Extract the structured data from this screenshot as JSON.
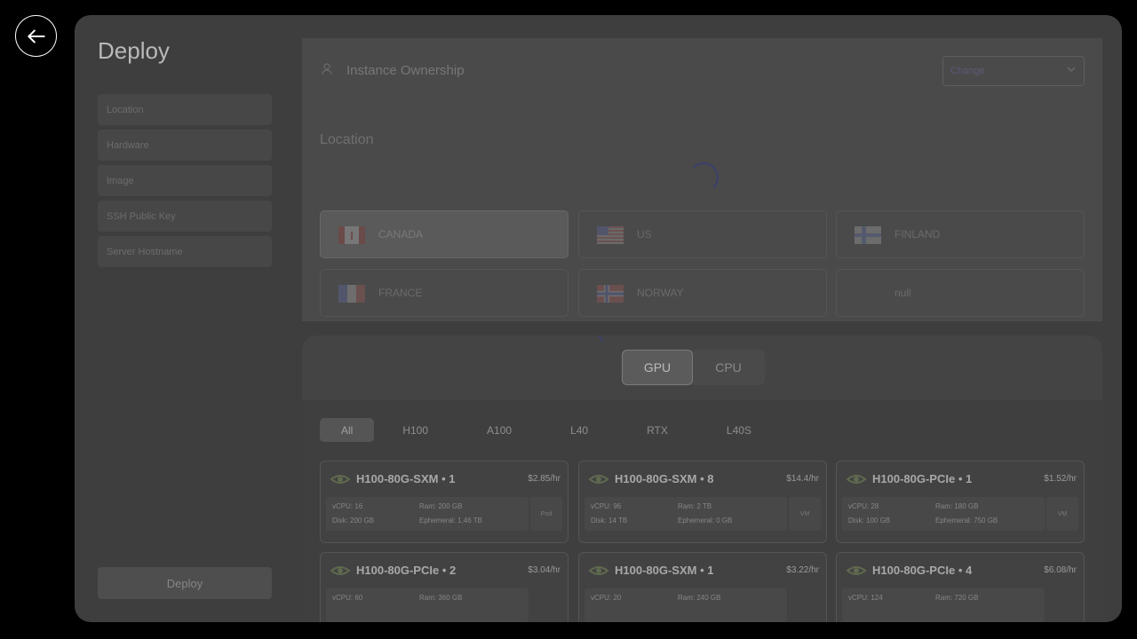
{
  "back_icon": "arrow-left-icon",
  "title": "Deploy",
  "nav": [
    "Location",
    "Hardware",
    "Image",
    "SSH Public Key",
    "Server Hostname"
  ],
  "deploy_label": "Deploy",
  "ownership": {
    "icon": "person-icon",
    "label": "Instance Ownership",
    "select_value": "Change"
  },
  "location": {
    "title": "Location",
    "items": [
      {
        "name": "CANADA",
        "flag": "canada-flag-icon",
        "selected": true
      },
      {
        "name": "US",
        "flag": "us-flag-icon",
        "selected": false
      },
      {
        "name": "FINLAND",
        "flag": "finland-flag-icon",
        "selected": false
      },
      {
        "name": "FRANCE",
        "flag": "france-flag-icon",
        "selected": false
      },
      {
        "name": "NORWAY",
        "flag": "norway-flag-icon",
        "selected": false
      },
      {
        "name": "null",
        "flag": "",
        "selected": false
      }
    ]
  },
  "hardware": {
    "types": [
      "GPU",
      "CPU"
    ],
    "active_type": "GPU",
    "filters": [
      "All",
      "H100",
      "A100",
      "L40",
      "RTX",
      "L40S"
    ],
    "active_filter": "All",
    "cards": [
      {
        "name": "H100-80G-SXM • 1",
        "price": "$2.85/hr",
        "vcpu": "vCPU: 16",
        "ram": "Ram: 200 GB",
        "disk": "Disk: 200 GB",
        "eph": "Ephemeral: 1.46 TB",
        "badge": "Pod"
      },
      {
        "name": "H100-80G-SXM • 8",
        "price": "$14.4/hr",
        "vcpu": "vCPU: 96",
        "ram": "Ram: 2 TB",
        "disk": "Disk: 14 TB",
        "eph": "Ephemeral: 0 GB",
        "badge": "VM"
      },
      {
        "name": "H100-80G-PCIe • 1",
        "price": "$1.52/hr",
        "vcpu": "vCPU: 28",
        "ram": "Ram: 180 GB",
        "disk": "Disk: 100 GB",
        "eph": "Ephemeral: 750 GB",
        "badge": "VM"
      },
      {
        "name": "H100-80G-PCIe • 2",
        "price": "$3.04/hr",
        "vcpu": "vCPU: 60",
        "ram": "Ram: 360 GB",
        "disk": "",
        "eph": "",
        "badge": ""
      },
      {
        "name": "H100-80G-SXM • 1",
        "price": "$3.22/hr",
        "vcpu": "vCPU: 20",
        "ram": "Ram: 240 GB",
        "disk": "",
        "eph": "",
        "badge": ""
      },
      {
        "name": "H100-80G-PCIe • 4",
        "price": "$6.08/hr",
        "vcpu": "vCPU: 124",
        "ram": "Ram: 720 GB",
        "disk": "",
        "eph": "",
        "badge": ""
      }
    ]
  },
  "colors": {
    "overlay": "#3e3e3e",
    "spinner": "#3a3f6f"
  }
}
